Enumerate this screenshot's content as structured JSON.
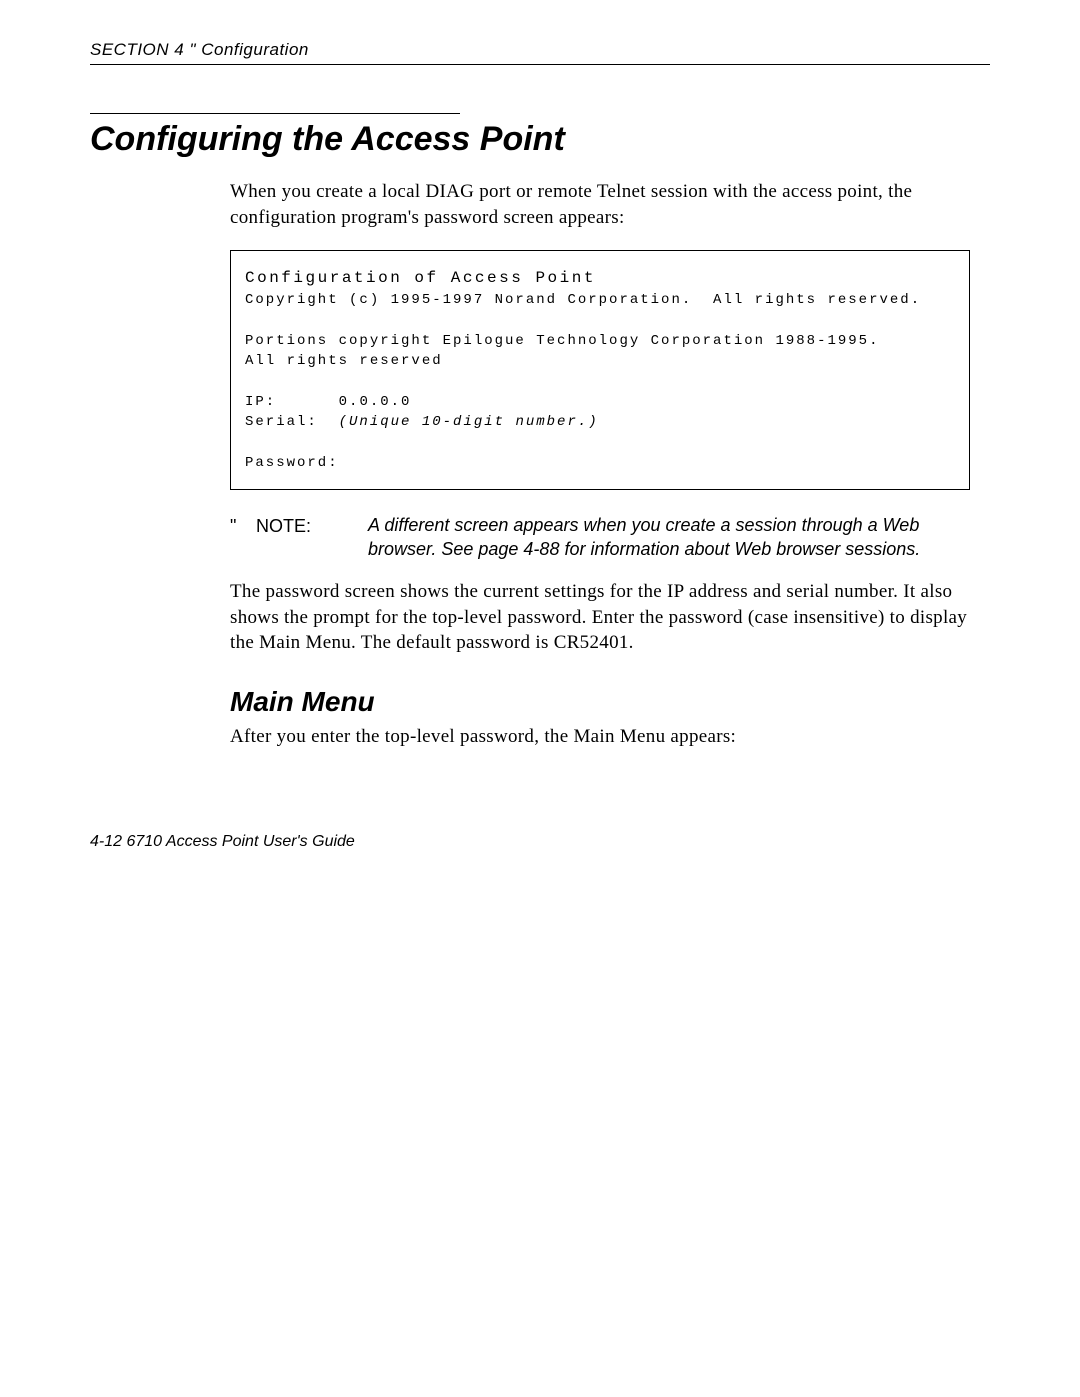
{
  "header": {
    "section_label": "SECTION 4",
    "separator": " \" ",
    "section_name": "Configuration"
  },
  "title": "Configuring the Access Point",
  "intro_para": "When you create a local DIAG port or remote Telnet session with the access point, the configuration program's password screen appears:",
  "terminal": {
    "line1": "Configuration of Access Point",
    "line2": "Copyright (c) 1995-1997 Norand Corporation.  All rights reserved.",
    "line4": "Portions copyright Epilogue Technology Corporation 1988-1995.",
    "line5": "All rights reserved",
    "ip_label": "IP:",
    "ip_value": "0.0.0.0",
    "serial_label": "Serial:",
    "serial_value": "(Unique 10-digit number.)",
    "password_label": "Password:"
  },
  "note": {
    "mark": "\"",
    "label": "NOTE:",
    "text": "A different screen appears when you create a session through a Web browser.  See page 4-88 for information about Web browser sessions."
  },
  "body2": "The password screen shows the current settings for the IP address and serial number.  It also shows the prompt for the top-level password.  Enter the password (case insensitive) to display the Main Menu.  The default password is CR52401.",
  "subheading": "Main Menu",
  "body3": "After you enter the top-level password, the Main Menu appears:",
  "footer": "4-12   6710 Access Point User's Guide"
}
